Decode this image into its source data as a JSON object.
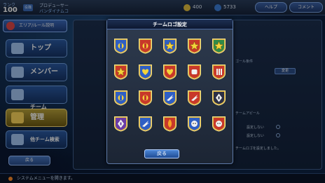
{
  "topbar": {
    "rank_label": "ランク",
    "rank_value": "100",
    "rank_badge": "役職",
    "player_label": "プロデューサー",
    "player_name": "バンダイナムコ",
    "coins": "400",
    "gems": "5733",
    "help_label": "ヘルプ",
    "comment_label": "コメント"
  },
  "menu": {
    "header": "エリア/ルール説明",
    "items": [
      {
        "label": "トップ"
      },
      {
        "label": "メンバー"
      },
      {
        "label": "チーム\nボーナス"
      },
      {
        "label": "管理"
      },
      {
        "label": "他チーム検索"
      }
    ],
    "back_label": "戻る"
  },
  "bottom_bar": {
    "text": "システムメニューを開きます。"
  },
  "right_panel": {
    "label_1": "ゴール条件",
    "btn_label": "変更",
    "label_2": "チームアピール",
    "opt_1": "設定しない",
    "opt_2": "設定しない",
    "note": "チームロゴを設定しました。"
  },
  "modal": {
    "title": "チームロゴ設定",
    "back_label": "戻る",
    "emblems": [
      {
        "icon": "emblem-gundam-head",
        "color": "#2f5fc4"
      },
      {
        "icon": "emblem-zeon-lion",
        "color": "#c8382a"
      },
      {
        "icon": "emblem-star-blue",
        "color": "#2f5fc4"
      },
      {
        "icon": "emblem-star-red",
        "color": "#c8382a"
      },
      {
        "icon": "emblem-star-green",
        "color": "#2f8a48"
      },
      {
        "icon": "emblem-winged-star",
        "color": "#c8382a"
      },
      {
        "icon": "emblem-heart-blue",
        "color": "#2f5fc4"
      },
      {
        "icon": "emblem-heart-red",
        "color": "#c8382a"
      },
      {
        "icon": "emblem-fist",
        "color": "#c8382a"
      },
      {
        "icon": "emblem-bars",
        "color": "#c8382a"
      },
      {
        "icon": "emblem-shield-blue",
        "color": "#2f5fc4"
      },
      {
        "icon": "emblem-crest-red",
        "color": "#c8382a"
      },
      {
        "icon": "emblem-wing-blue",
        "color": "#2f5fc4"
      },
      {
        "icon": "emblem-wing-red",
        "color": "#c8382a"
      },
      {
        "icon": "emblem-cross-dark",
        "color": "#2b2f45"
      },
      {
        "icon": "emblem-diamond-purple",
        "color": "#6a3ba8"
      },
      {
        "icon": "emblem-claw-blue",
        "color": "#2f5fc4"
      },
      {
        "icon": "emblem-flame-red",
        "color": "#c8382a"
      },
      {
        "icon": "emblem-face-blue",
        "color": "#2f5fc4"
      },
      {
        "icon": "emblem-face-red",
        "color": "#c8382a"
      }
    ]
  }
}
